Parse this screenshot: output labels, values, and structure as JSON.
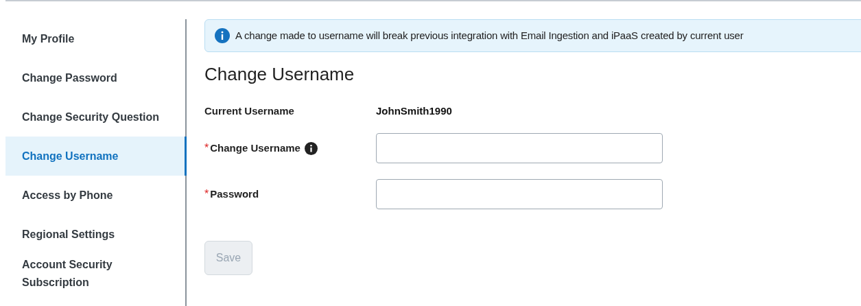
{
  "sidebar": {
    "items": [
      {
        "label": "My Profile",
        "selected": false
      },
      {
        "label": "Change Password",
        "selected": false
      },
      {
        "label": "Change Security Question",
        "selected": false
      },
      {
        "label": "Change Username",
        "selected": true
      },
      {
        "label": "Access by Phone",
        "selected": false
      },
      {
        "label": "Regional Settings",
        "selected": false
      },
      {
        "label": "Account Security Subscription",
        "selected": false
      }
    ]
  },
  "banner": {
    "text": "A change made to username will break previous integration with Email Ingestion and iPaaS created by current user"
  },
  "heading": "Change Username",
  "current": {
    "label": "Current Username",
    "value": "JohnSmith1990"
  },
  "fields": [
    {
      "marker": "*",
      "label": "Change Username",
      "info": true
    },
    {
      "marker": "*",
      "label": "Password",
      "info": false
    }
  ],
  "save": {
    "label": "Save",
    "disabled": true
  }
}
